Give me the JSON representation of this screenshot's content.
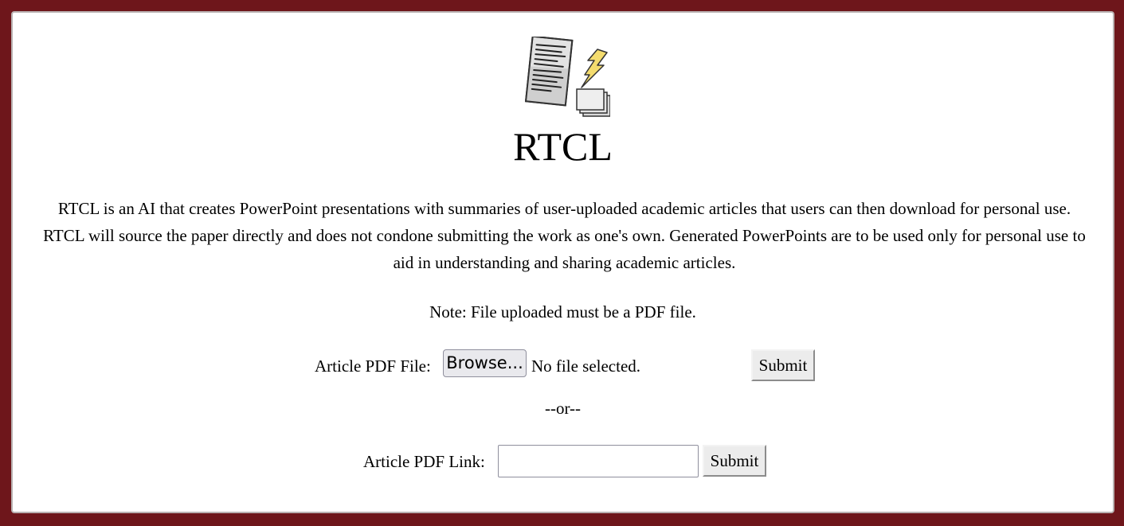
{
  "app": {
    "title": "RTCL",
    "logo_icon": "document-lightning-slides-icon"
  },
  "description": "RTCL is an AI that creates PowerPoint presentations with summaries of user-uploaded academic articles that users can then download for personal use. RTCL will source the paper directly and does not condone submitting the work as one's own. Generated PowerPoints are to be used only for personal use to aid in understanding and sharing academic articles.",
  "note": "Note: File uploaded must be a PDF file.",
  "file_upload": {
    "label": "Article PDF File:",
    "browse_label": "Browse...",
    "status": "No file selected.",
    "submit_label": "Submit"
  },
  "separator": "--or--",
  "link_upload": {
    "label": "Article PDF Link:",
    "value": "",
    "submit_label": "Submit"
  },
  "colors": {
    "background": "#6e161b",
    "panel": "#ffffff",
    "lightning": "#f4dc6e"
  }
}
